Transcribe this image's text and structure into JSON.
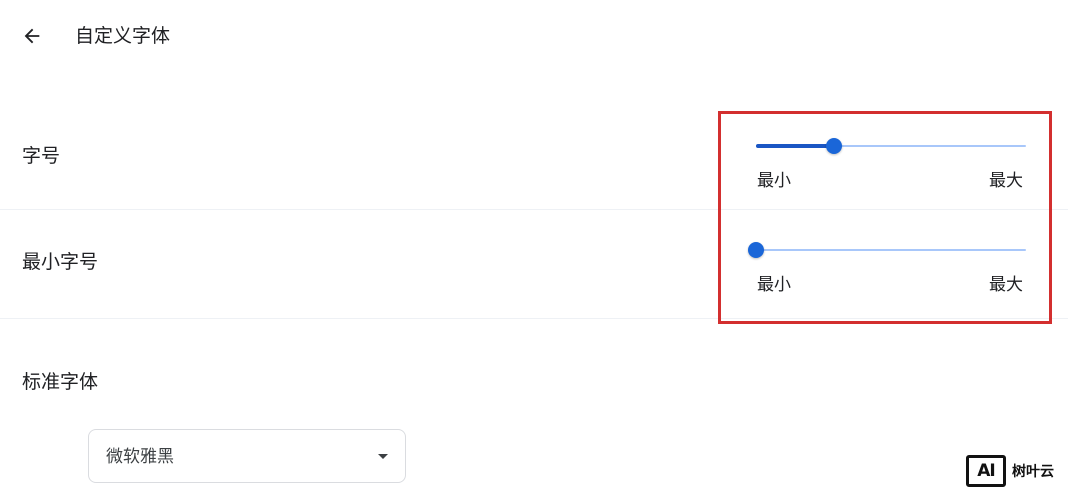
{
  "header": {
    "back_icon": "arrow-left-icon",
    "title": "自定义字体"
  },
  "font_size": {
    "label": "字号",
    "value_fraction": 0.29,
    "min_label": "最小",
    "max_label": "最大"
  },
  "min_font_size": {
    "label": "最小字号",
    "value_fraction": 0.0,
    "min_label": "最小",
    "max_label": "最大"
  },
  "standard_font": {
    "label": "标准字体",
    "selected": "微软雅黑",
    "caret_icon": "dropdown-caret-icon"
  },
  "highlight": {
    "color": "#d32f2f"
  },
  "watermark": {
    "logo_text": "AI",
    "brand": "树叶云"
  },
  "colors": {
    "accent": "#1a66d8",
    "track": "#a8c7fa"
  }
}
